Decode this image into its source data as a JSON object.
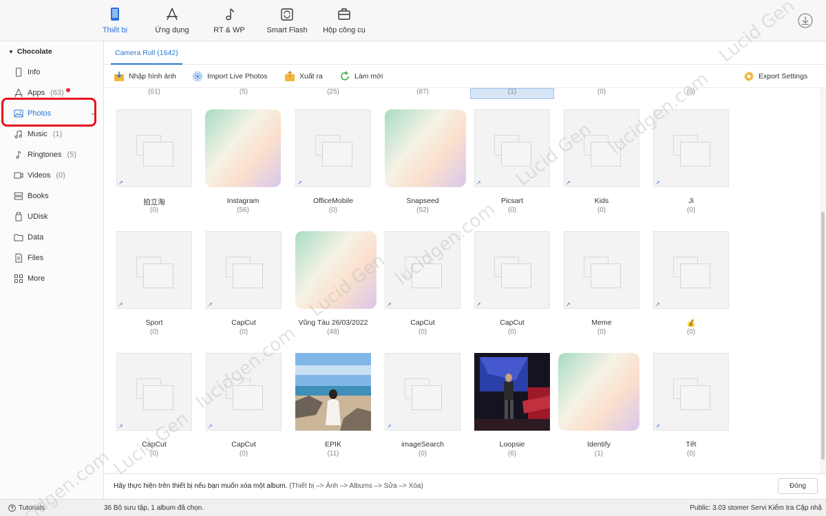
{
  "topbar": {
    "tabs": [
      {
        "label": "Thiết bị",
        "icon": "phone-icon",
        "active": true
      },
      {
        "label": "Ứng dụng",
        "icon": "app-store-icon",
        "active": false
      },
      {
        "label": "RT & WP",
        "icon": "music-note-icon",
        "active": false
      },
      {
        "label": "Smart Flash",
        "icon": "flash-refresh-icon",
        "active": false
      },
      {
        "label": "Hộp công cụ",
        "icon": "toolbox-icon",
        "active": false
      }
    ],
    "right_icon": "download-icon"
  },
  "sidebar": {
    "device_name": "Chocolate",
    "items": [
      {
        "label": "Info",
        "count": "",
        "icon": "phone-icon"
      },
      {
        "label": "Apps",
        "count": "(63)",
        "icon": "app-store-icon"
      },
      {
        "label": "Photos",
        "count": "",
        "icon": "photo-icon"
      },
      {
        "label": "Music",
        "count": "(1)",
        "icon": "music-icon"
      },
      {
        "label": "Ringtones",
        "count": "(5)",
        "icon": "ringtone-icon"
      },
      {
        "label": "Videos",
        "count": "(0)",
        "icon": "video-icon"
      },
      {
        "label": "Books",
        "count": "",
        "icon": "books-icon"
      },
      {
        "label": "UDisk",
        "count": "",
        "icon": "udisk-icon"
      },
      {
        "label": "Data",
        "count": "",
        "icon": "folder-icon"
      },
      {
        "label": "Files",
        "count": "",
        "icon": "file-icon"
      },
      {
        "label": "More",
        "count": "",
        "icon": "grid-icon"
      }
    ]
  },
  "main": {
    "tab": "Camera Roll (1642)",
    "actions": {
      "import_photos": "Nhập hình ảnh",
      "import_live": "Import Live Photos",
      "export": "Xuất ra",
      "refresh": "Làm mới",
      "export_settings": "Export Settings"
    },
    "partial_counts": [
      "(61)",
      "(5)",
      "(25)",
      "(87)",
      "(1)",
      "(0)",
      "(0)"
    ],
    "albums": [
      {
        "name": "拍立淘",
        "count": "(0)",
        "thumb": "placeholder"
      },
      {
        "name": "Instagram",
        "count": "(56)",
        "thumb": "gradient"
      },
      {
        "name": "OfficeMobile",
        "count": "(0)",
        "thumb": "placeholder"
      },
      {
        "name": "Snapseed",
        "count": "(52)",
        "thumb": "gradient"
      },
      {
        "name": "Picsart",
        "count": "(0)",
        "thumb": "placeholder"
      },
      {
        "name": "Kids",
        "count": "(0)",
        "thumb": "placeholder"
      },
      {
        "name": "Ji",
        "count": "(0)",
        "thumb": "placeholder"
      },
      {
        "name": "Sport",
        "count": "(0)",
        "thumb": "placeholder"
      },
      {
        "name": "CapCut",
        "count": "(0)",
        "thumb": "placeholder"
      },
      {
        "name": "Vũng Tàu 26/03/2022",
        "count": "(48)",
        "thumb": "gradient"
      },
      {
        "name": "CapCut",
        "count": "(0)",
        "thumb": "placeholder"
      },
      {
        "name": "CapCut",
        "count": "(0)",
        "thumb": "placeholder"
      },
      {
        "name": "Meme",
        "count": "(0)",
        "thumb": "placeholder"
      },
      {
        "name": "💰",
        "count": "(0)",
        "thumb": "placeholder"
      },
      {
        "name": "CapCut",
        "count": "(0)",
        "thumb": "placeholder"
      },
      {
        "name": "CapCut",
        "count": "(0)",
        "thumb": "placeholder"
      },
      {
        "name": "EPIK",
        "count": "(11)",
        "thumb": "beach-photo"
      },
      {
        "name": "imageSearch",
        "count": "(0)",
        "thumb": "placeholder"
      },
      {
        "name": "Loopsie",
        "count": "(6)",
        "thumb": "stage-photo"
      },
      {
        "name": "Identify",
        "count": "(1)",
        "thumb": "gradient"
      },
      {
        "name": "Tết",
        "count": "(0)",
        "thumb": "placeholder"
      }
    ]
  },
  "notice": {
    "text": "Hãy thực hiện trên thiết bị nếu bạn muốn xóa một album.",
    "path": "(Thiết bị –> Ảnh –> Albums –> Sửa –> Xóa)",
    "close_label": "Đóng"
  },
  "statusbar": {
    "tutorials": "Tutorials",
    "selection": "36 Bộ sưu tập, 1 album đã chọn.",
    "right_text": "Public: 3.03   stomer Servi  Kiểm tra Cập nhậ"
  },
  "watermark": {
    "text_a": "lucidgen.com",
    "text_b": "Lucid Gen"
  },
  "colors": {
    "accent": "#2a73d6",
    "highlight_red": "#e8101e",
    "badge_red": "#e4283a"
  }
}
